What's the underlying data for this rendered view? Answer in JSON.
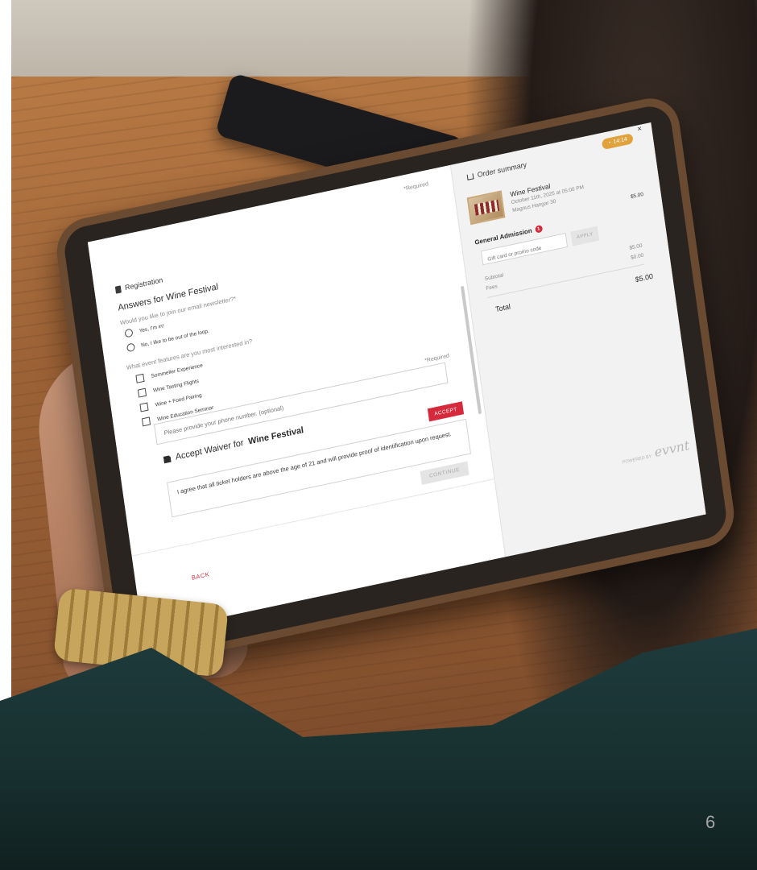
{
  "registration": {
    "required_top": "*Required",
    "title": "Registration",
    "answers_title": "Answers for Wine Festival",
    "q1": "Would you like to join our email newsletter?*",
    "radio_options": [
      "Yes, I'm in!",
      "No, I like to be out of the loop."
    ],
    "q2": "What event features are you most interested in?",
    "check_options": [
      "Sommelier Experience",
      "Wine Tasting Flights",
      "Wine + Food Pairing",
      "Wine Education Seminar"
    ],
    "phone_placeholder": "Please provide your phone number. (optional)",
    "required_mid": "*Required",
    "waiver_prefix": "Accept Waiver for",
    "waiver_event": "Wine Festival",
    "accept_label": "ACCEPT",
    "waiver_text": "I agree that all ticket holders are above the age of 21 and will provide proof of identification upon request.",
    "continue_label": "CONTINUE",
    "back_label": "BACK"
  },
  "order": {
    "title": "Order summary",
    "timer": "14:14",
    "close": "×",
    "event_name": "Wine Festival",
    "event_date": "October 11th, 2025 at 05:00 PM",
    "event_venue": "Magnus Hangar 30",
    "ticket_price": "$5.00",
    "ticket_type": "General Admission",
    "ticket_count": "1",
    "promo_placeholder": "Gift card or promo code",
    "apply_label": "APPLY",
    "subtotal_label": "Subtotal",
    "subtotal_value": "$5.00",
    "fees_label": "Fees",
    "fees_value": "$0.00",
    "total_label": "Total",
    "total_value": "$5.00",
    "powered_label": "POWERED BY",
    "powered_logo": "evvnt"
  },
  "slide": {
    "page_number": "6"
  },
  "colors": {
    "accent_red": "#d6293b",
    "timer_orange": "#e0a23c",
    "panel_gray": "#f2f2f2"
  }
}
